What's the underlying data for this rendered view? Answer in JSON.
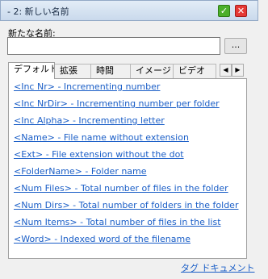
{
  "panel": {
    "title": "- 2: 新しい名前",
    "check_glyph": "✓",
    "close_glyph": "✕"
  },
  "form": {
    "new_name_label": "新たな名前:",
    "new_name_value": "",
    "browse_label": "..."
  },
  "tabs": [
    {
      "label": "デフォルト",
      "active": true
    },
    {
      "label": "拡張",
      "active": false
    },
    {
      "label": "時間",
      "active": false
    },
    {
      "label": "イメージ",
      "active": false
    },
    {
      "label": "ビデオ",
      "active": false
    }
  ],
  "tab_scroll": {
    "left": "◀",
    "right": "▶"
  },
  "tags": [
    "<Inc Nr> - Incrementing number",
    "<Inc NrDir> - Incrementing number per folder",
    "<Inc Alpha> - Incrementing letter",
    "<Name> - File name without extension",
    "<Ext> - File extension without the dot",
    "<FolderName> - Folder name",
    "<Num Files> - Total number of files in the folder",
    "<Num Dirs> - Total number of folders in the folder",
    "<Num Items> - Total number of files in the list",
    "<Word> - Indexed word of the filename"
  ],
  "footer": {
    "doc_link": "タグ ドキュメント"
  },
  "colors": {
    "link": "#1a5ec7",
    "check": "#4caf2b",
    "close": "#e53935"
  }
}
